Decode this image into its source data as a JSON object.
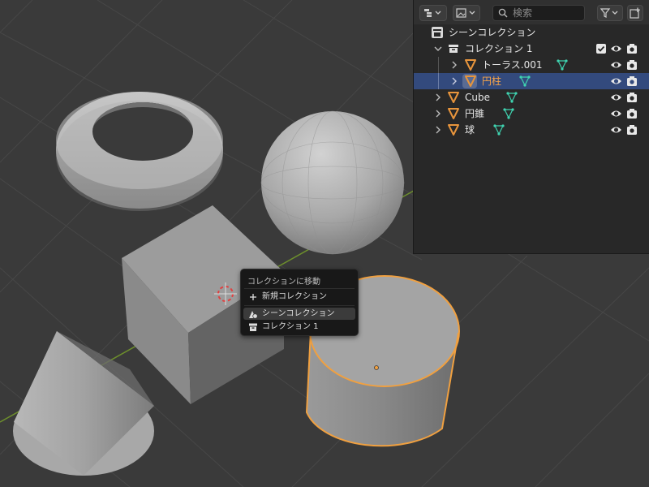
{
  "outliner": {
    "search": {
      "placeholder": "検索"
    },
    "rows": [
      {
        "label": "シーンコレクション",
        "kind": "scene-collection"
      },
      {
        "label": "コレクション 1",
        "kind": "collection",
        "expanded": true,
        "checked": true
      },
      {
        "label": "トーラス.001",
        "kind": "object",
        "selected": false
      },
      {
        "label": "円柱",
        "kind": "object",
        "selected": true
      },
      {
        "label": "Cube",
        "kind": "object",
        "selected": false
      },
      {
        "label": "円錐",
        "kind": "object",
        "selected": false
      },
      {
        "label": "球",
        "kind": "object",
        "selected": false
      }
    ]
  },
  "menu": {
    "title": "コレクションに移動",
    "items": [
      {
        "label": "新規コレクション",
        "icon": "plus-icon"
      },
      {
        "label": "シーンコレクション",
        "icon": "scene-collection-icon",
        "highlighted": true
      },
      {
        "label": "コレクション 1",
        "icon": "collection-icon"
      }
    ]
  },
  "colors": {
    "object_orange": "#e8953c",
    "mesh_teal": "#3fd3b0",
    "selection_blue": "#334a7d",
    "active_outline": "#f0a040"
  }
}
